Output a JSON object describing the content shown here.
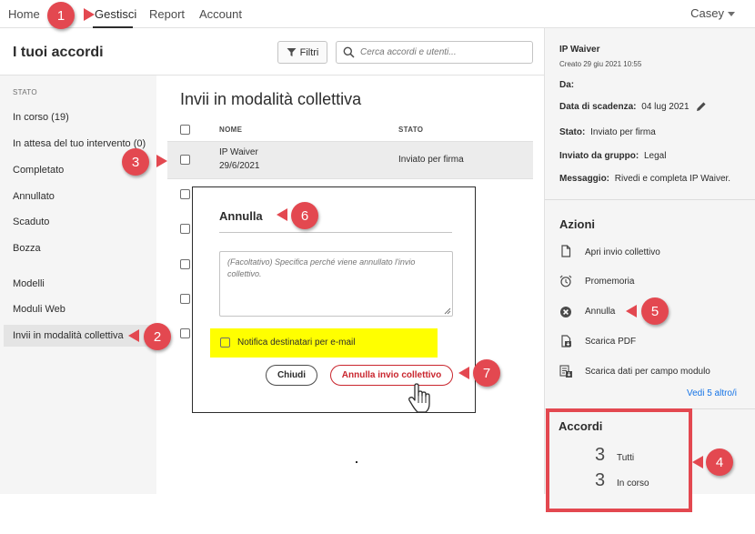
{
  "nav": {
    "home": "Home",
    "manage": "Gestisci",
    "report": "Report",
    "account": "Account",
    "user": "Casey"
  },
  "page": {
    "title": "I tuoi accordi",
    "filter_label": "Filtri",
    "search_placeholder": "Cerca accordi e utenti..."
  },
  "sidebar": {
    "section_label": "STATO",
    "items": [
      "In corso (19)",
      "In attesa del tuo intervento (0)",
      "Completato",
      "Annullato",
      "Scaduto",
      "Bozza",
      "Modelli",
      "Moduli Web",
      "Invii in modalità collettiva"
    ]
  },
  "main": {
    "title": "Invii in modalità collettiva",
    "columns": [
      "NOME",
      "STATO"
    ],
    "rows": [
      {
        "name": "IP Waiver",
        "date": "29/6/2021",
        "status": "Inviato per firma"
      }
    ]
  },
  "details": {
    "name": "IP Waiver",
    "created": "Creato 29 giu 2021 10:55",
    "from_label": "Da:",
    "due_label": "Data di scadenza:",
    "due_value": "04 lug 2021",
    "status_label": "Stato:",
    "status_value": "Inviato per firma",
    "group_label": "Inviato da gruppo:",
    "group_value": "Legal",
    "message_label": "Messaggio:",
    "message_value": "Rivedi e completa IP Waiver."
  },
  "actions": {
    "heading": "Azioni",
    "items": [
      {
        "label": "Apri invio collettivo",
        "icon": "document-icon"
      },
      {
        "label": "Promemoria",
        "icon": "alarm-clock-icon"
      },
      {
        "label": "Annulla",
        "icon": "cancel-circle-icon"
      },
      {
        "label": "Scarica PDF",
        "icon": "download-pdf-icon"
      },
      {
        "label": "Scarica dati per campo modulo",
        "icon": "download-data-icon"
      }
    ],
    "more": "Vedi 5 altro/i"
  },
  "agreements": {
    "heading": "Accordi",
    "total_count": "3",
    "total_label": "Tutti",
    "in_progress_count": "3",
    "in_progress_label": "In corso"
  },
  "dialog": {
    "title": "Annulla",
    "reason_placeholder": "(Facoltativo) Specifica perché viene annullato l'invio collettivo.",
    "notify_label": "Notifica destinatari per e-mail",
    "close_button": "Chiudi",
    "confirm_button": "Annulla invio collettivo"
  },
  "callouts": [
    "1",
    "2",
    "3",
    "4",
    "5",
    "6",
    "7"
  ],
  "colors": {
    "callout": "#e34850",
    "highlight": "#ffff00",
    "confirm": "#c9252d",
    "link": "#1473e6"
  }
}
